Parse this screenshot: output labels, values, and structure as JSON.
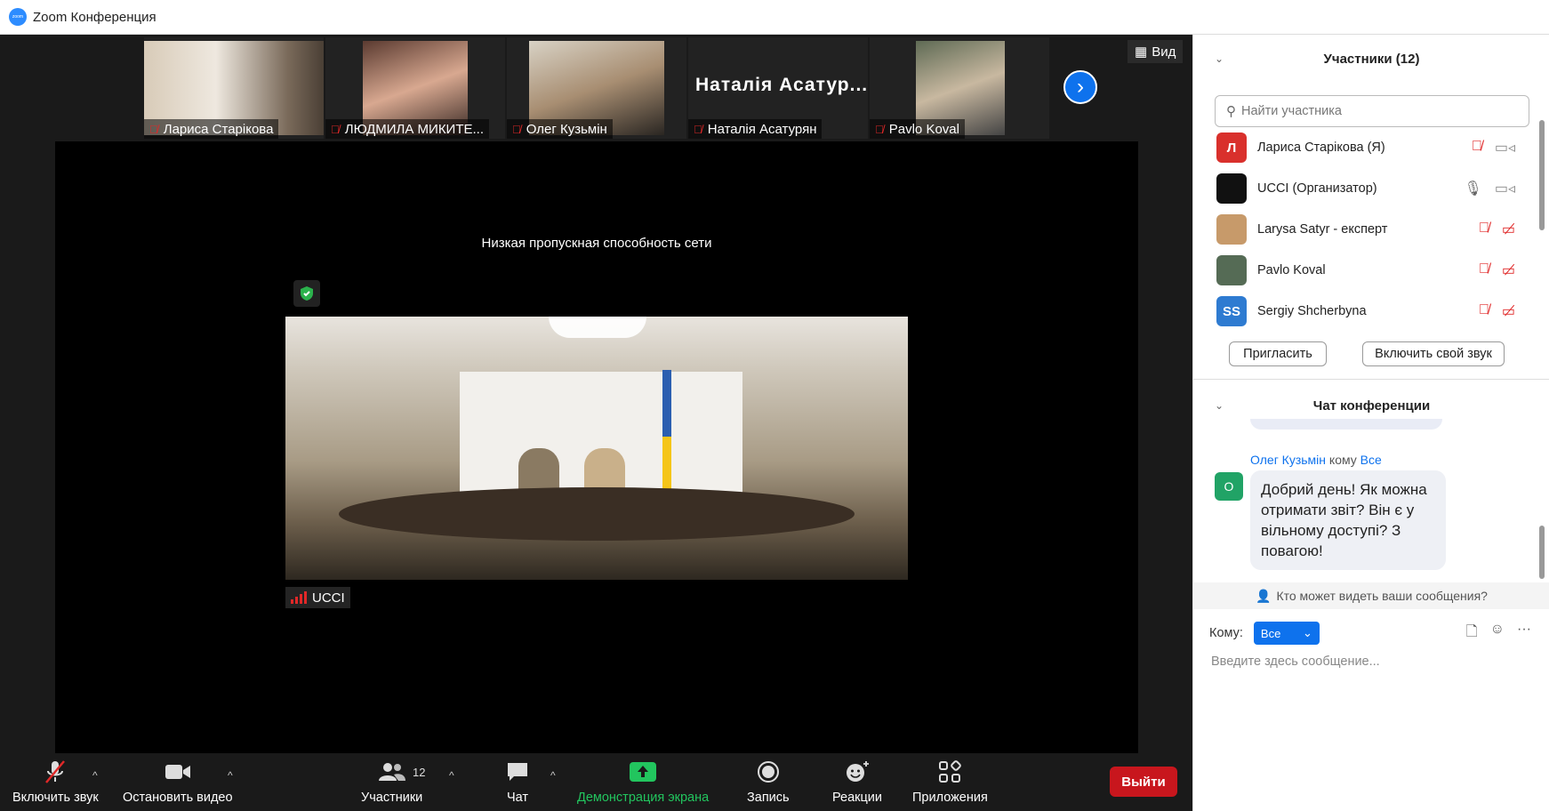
{
  "window": {
    "title": "Zoom Конференция",
    "logo_text": "zoom"
  },
  "strip": {
    "thumbs": [
      {
        "name": "Лариса Старікова",
        "muted": true
      },
      {
        "name": "ЛЮДМИЛА МИКИТЕ...",
        "muted": true
      },
      {
        "name": "Олег Кузьмін",
        "muted": true
      },
      {
        "name": "Наталія Асатурян",
        "muted": true,
        "display_name": "Наталія Асатур..."
      },
      {
        "name": "Pavlo Koval",
        "muted": true
      }
    ],
    "view_label": "Вид"
  },
  "main_video": {
    "status": "Низкая пропускная способность сети",
    "speaker": "UCCI"
  },
  "toolbar": {
    "unmute": "Включить звук",
    "stop_video": "Остановить видео",
    "participants": "Участники",
    "participants_count": "12",
    "chat": "Чат",
    "share": "Демонстрация экрана",
    "record": "Запись",
    "reactions": "Реакции",
    "apps": "Приложения",
    "leave": "Выйти"
  },
  "participants_panel": {
    "title": "Участники (12)",
    "search_placeholder": "Найти участника",
    "list": [
      {
        "initial": "Л",
        "name": "Лариса Старікова (Я)",
        "color": "#d9302c",
        "mic": "muted",
        "cam": "on"
      },
      {
        "initial": "",
        "name": "UCCI (Организатор)",
        "color": "#111111",
        "mic": "on",
        "cam": "on"
      },
      {
        "initial": "",
        "name": "Larysa Satyr - експерт",
        "color": "#c79a6a",
        "mic": "muted",
        "cam": "off"
      },
      {
        "initial": "",
        "name": "Pavlo Koval",
        "color": "#556b55",
        "mic": "muted",
        "cam": "off"
      },
      {
        "initial": "SS",
        "name": "Sergiy Shcherbyna",
        "color": "#2e7bd1",
        "mic": "muted",
        "cam": "off"
      }
    ],
    "invite": "Пригласить",
    "unmute_self": "Включить свой звук"
  },
  "chat_panel": {
    "title": "Чат конференции",
    "message": {
      "sender": "Олег Кузьмін",
      "to_word": "кому",
      "recipient": "Все",
      "avatar": "О",
      "text": "Добрий день! Як можна отримати звіт? Він є у вільному доступі? З повагою!"
    },
    "who_can_see": "Кто может видеть ваши сообщения?",
    "to_label": "Кому:",
    "to_value": "Все",
    "input_placeholder": "Введите здесь сообщение..."
  }
}
